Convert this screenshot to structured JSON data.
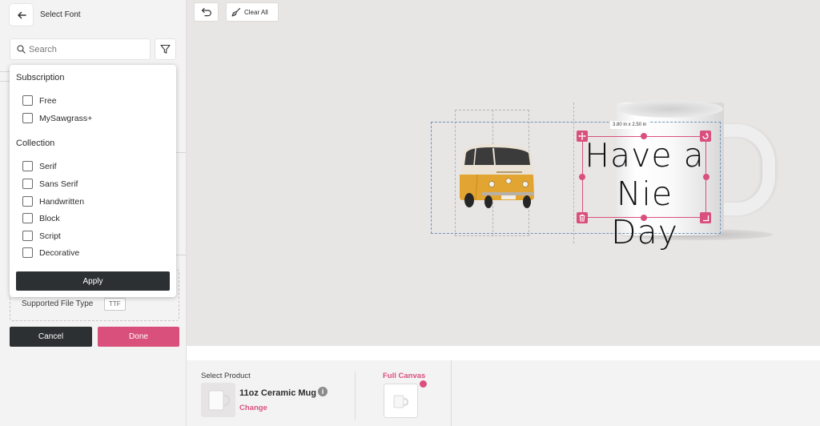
{
  "sidebar": {
    "title": "Select Font",
    "search_placeholder": "Search",
    "supported_file_type_label": "Supported File Type",
    "supported_file_type_value": "TTF",
    "cancel_label": "Cancel",
    "done_label": "Done"
  },
  "filter_dropdown": {
    "subscription_heading": "Subscription",
    "subscription_items": [
      {
        "label": "Free",
        "checked": false
      },
      {
        "label": "MySawgrass+",
        "checked": false
      }
    ],
    "collection_heading": "Collection",
    "collection_items": [
      {
        "label": "Serif",
        "checked": false
      },
      {
        "label": "Sans Serif",
        "checked": false
      },
      {
        "label": "Handwritten",
        "checked": false
      },
      {
        "label": "Block",
        "checked": false
      },
      {
        "label": "Script",
        "checked": false
      },
      {
        "label": "Decorative",
        "checked": false
      }
    ],
    "apply_label": "Apply"
  },
  "toolbar": {
    "clear_all_label": "Clear All"
  },
  "canvas": {
    "dimension_label": "3.80 in x 2.50 in",
    "text_line_1": "Have a",
    "text_line_2": "Nie Day"
  },
  "bottom_panel": {
    "select_product_label": "Select Product",
    "product_name": "11oz Ceramic Mug",
    "change_label": "Change",
    "full_canvas_label": "Full Canvas"
  },
  "colors": {
    "accent": "#d9507c",
    "dark_button": "#2d3032",
    "canvas_bg": "#e8e5e5",
    "print_area_border": "#6f93b8"
  }
}
